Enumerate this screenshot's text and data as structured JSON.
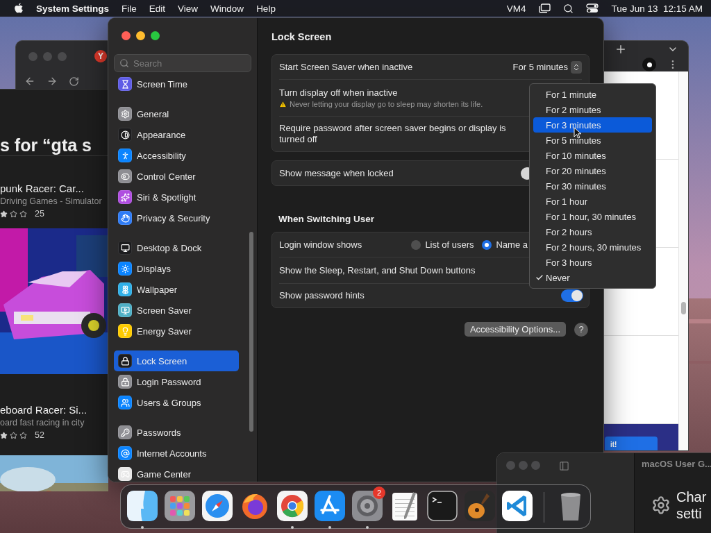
{
  "menu_bar": {
    "app": "System Settings",
    "menus": [
      "File",
      "Edit",
      "View",
      "Window",
      "Help"
    ],
    "status_text": "VM4",
    "clock": "Tue Jun 13  12:15 AM"
  },
  "browser_left": {
    "tab_logo": "Y"
  },
  "app_store": {
    "heading": "s for “gta s",
    "results": [
      {
        "title": "punk Racer: Car...",
        "subtitle": "Driving Games - Simulator",
        "stars": 1,
        "rating_count": "25"
      },
      {
        "title": "eboard Racer: Si...",
        "subtitle": "oard fast racing in city",
        "stars": 1,
        "rating_count": "52"
      }
    ]
  },
  "browser_right": {
    "banner_button": "it!"
  },
  "help_window": {
    "title": "macOS User G...",
    "item_lines": [
      "Char",
      "setti"
    ]
  },
  "settings": {
    "sidebar": {
      "search_placeholder": "Search",
      "groups": [
        {
          "items": [
            {
              "label": "Screen Time",
              "color": "#5e5ce6",
              "selected": false
            }
          ]
        },
        {
          "items": [
            {
              "label": "General",
              "color": "#8e8e93",
              "selected": false
            },
            {
              "label": "Appearance",
              "color": "#1c1c1e",
              "selected": false
            },
            {
              "label": "Accessibility",
              "color": "#0a84ff",
              "selected": false
            },
            {
              "label": "Control Center",
              "color": "#8e8e93",
              "selected": false
            },
            {
              "label": "Siri & Spotlight",
              "color": "#b04ee0",
              "selected": false
            },
            {
              "label": "Privacy & Security",
              "color": "#2f7cf6",
              "selected": false
            }
          ]
        },
        {
          "items": [
            {
              "label": "Desktop & Dock",
              "color": "#1c1c1e",
              "selected": false
            },
            {
              "label": "Displays",
              "color": "#0a84ff",
              "selected": false
            },
            {
              "label": "Wallpaper",
              "color": "#30b0e8",
              "selected": false
            },
            {
              "label": "Screen Saver",
              "color": "#4fb0c6",
              "selected": false
            },
            {
              "label": "Energy Saver",
              "color": "#ffcc00",
              "selected": false
            }
          ]
        },
        {
          "items": [
            {
              "label": "Lock Screen",
              "color": "#1c1c1e",
              "selected": true
            },
            {
              "label": "Login Password",
              "color": "#8e8e93",
              "selected": false
            },
            {
              "label": "Users & Groups",
              "color": "#0a84ff",
              "selected": false
            }
          ]
        },
        {
          "items": [
            {
              "label": "Passwords",
              "color": "#8e8e93",
              "selected": false
            },
            {
              "label": "Internet Accounts",
              "color": "#0a84ff",
              "selected": false
            },
            {
              "label": "Game Center",
              "color": "#e8e8e8",
              "selected": false
            }
          ]
        }
      ]
    },
    "content": {
      "title": "Lock Screen",
      "groups": [
        {
          "rows": [
            {
              "kind": "popup",
              "label": "Start Screen Saver when inactive",
              "value": "For 5 minutes"
            },
            {
              "kind": "warning",
              "label": "Turn display off when inactive",
              "note": "Never letting your display go to sleep may shorten its life."
            },
            {
              "kind": "plain",
              "label": "Require password after screen saver begins or display is turned off"
            }
          ]
        },
        {
          "rows": [
            {
              "kind": "covered",
              "label": "Show message when locked"
            }
          ]
        },
        {
          "header": "When Switching User",
          "rows": [
            {
              "kind": "radio",
              "label": "Login window shows",
              "options": [
                {
                  "label": "List of users",
                  "selected": false
                },
                {
                  "label": "Name a",
                  "selected": true
                }
              ]
            },
            {
              "kind": "plain",
              "label": "Show the Sleep, Restart, and Shut Down buttons"
            },
            {
              "kind": "toggle",
              "label": "Show password hints",
              "on": true
            }
          ]
        }
      ],
      "buttons": [
        {
          "kind": "text",
          "label": "Accessibility Options..."
        },
        {
          "kind": "help",
          "label": "?"
        }
      ]
    }
  },
  "popup_menu": {
    "items": [
      {
        "label": "For 1 minute",
        "selected": false,
        "checked": false
      },
      {
        "label": "For 2 minutes",
        "selected": false,
        "checked": false
      },
      {
        "label": "For 3 minutes",
        "selected": true,
        "checked": false
      },
      {
        "label": "For 5 minutes",
        "selected": false,
        "checked": false
      },
      {
        "label": "For 10 minutes",
        "selected": false,
        "checked": false
      },
      {
        "label": "For 20 minutes",
        "selected": false,
        "checked": false
      },
      {
        "label": "For 30 minutes",
        "selected": false,
        "checked": false
      },
      {
        "label": "For 1 hour",
        "selected": false,
        "checked": false
      },
      {
        "label": "For 1 hour, 30 minutes",
        "selected": false,
        "checked": false
      },
      {
        "label": "For 2 hours",
        "selected": false,
        "checked": false
      },
      {
        "label": "For 2 hours, 30 minutes",
        "selected": false,
        "checked": false
      },
      {
        "label": "For 3 hours",
        "selected": false,
        "checked": false
      },
      {
        "label": "Never",
        "selected": false,
        "checked": true
      }
    ]
  },
  "dock": {
    "apps": [
      {
        "kind": "finder",
        "running": true
      },
      {
        "kind": "launchpad",
        "running": false
      },
      {
        "kind": "safari",
        "running": false
      },
      {
        "kind": "firefox",
        "running": false
      },
      {
        "kind": "chrome",
        "running": true
      },
      {
        "kind": "appstore",
        "running": true
      },
      {
        "kind": "settings",
        "running": true,
        "badge": "2"
      },
      {
        "kind": "textedit",
        "running": false
      },
      {
        "kind": "terminal",
        "running": false
      },
      {
        "kind": "garageband",
        "running": false
      },
      {
        "kind": "vscode",
        "running": false
      },
      {
        "kind": "trash",
        "running": false
      }
    ]
  }
}
